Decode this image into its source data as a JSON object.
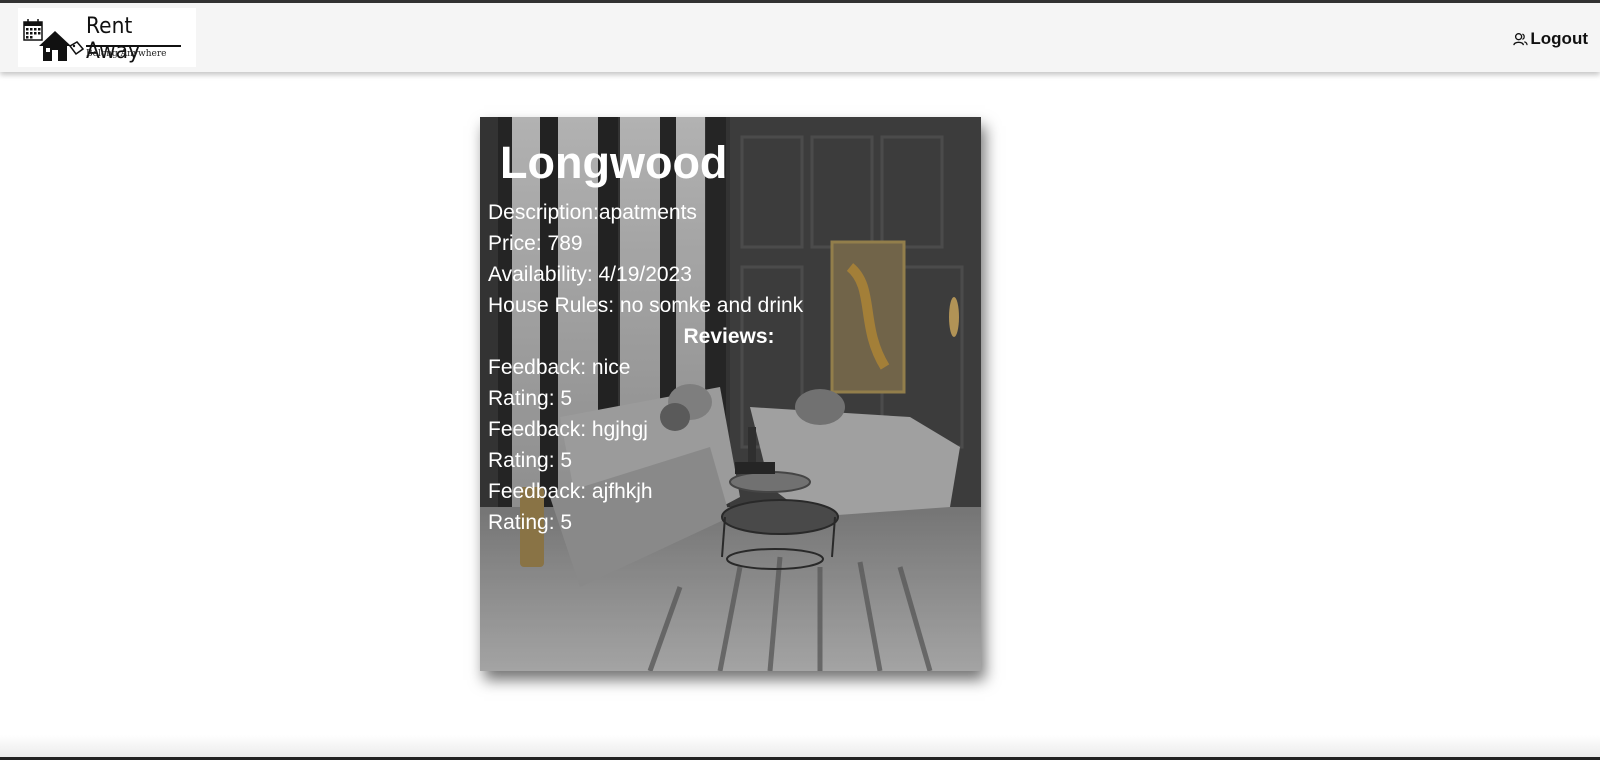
{
  "brand": {
    "name": "Rent Away",
    "tagline": "Belong Anywhere"
  },
  "nav": {
    "logout_label": "Logout",
    "logout_icon": "user-icon"
  },
  "listing": {
    "title": "Longwood",
    "description": "Description:apatments",
    "price": "Price: 789",
    "availability": "Availability: 4/19/2023",
    "house_rules": "House Rules: no somke and drink",
    "reviews_heading": "Reviews:",
    "reviews": [
      {
        "feedback": "Feedback: nice",
        "rating": "Rating: 5"
      },
      {
        "feedback": "Feedback: hgjhgj",
        "rating": "Rating: 5"
      },
      {
        "feedback": "Feedback: ajfhkjh",
        "rating": "Rating: 5"
      }
    ]
  },
  "colors": {
    "navbar_bg": "#f5f5f5",
    "card_text": "#ffffff",
    "card_overlay": "#000000"
  }
}
